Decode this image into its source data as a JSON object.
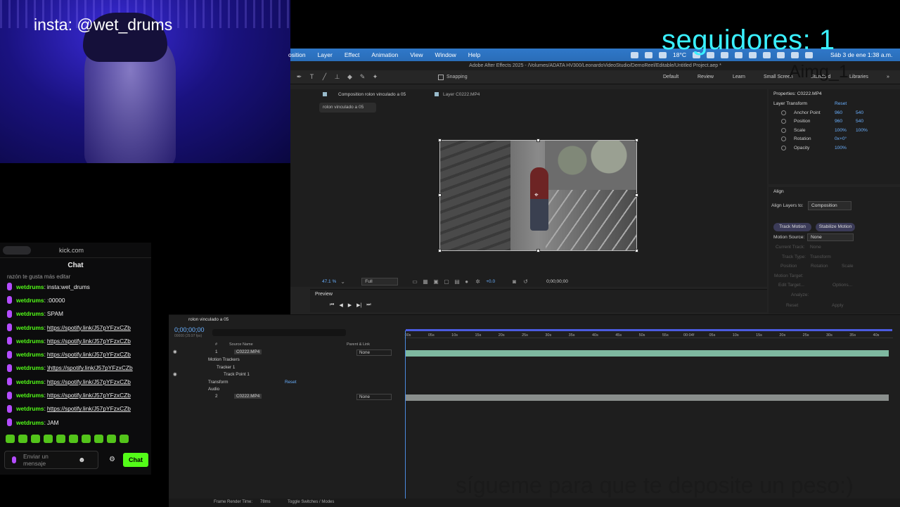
{
  "webcam": {
    "handle": "insta: @wet_drums"
  },
  "overlay": {
    "followers": "seguidores: 1",
    "aimg": "Aimg_1",
    "bottom_text": "sígueme para que te deposite un peso:)"
  },
  "chat": {
    "site": "kick.com",
    "title": "Chat",
    "cut_message": "razón te gusta más editar",
    "messages": [
      {
        "user": "wetdrums",
        "text": "insta:wet_drums",
        "link": false
      },
      {
        "user": "wetdrums",
        "text": ":00000",
        "link": false
      },
      {
        "user": "wetdrums",
        "text": "SPAM",
        "link": false
      },
      {
        "user": "wetdrums",
        "text": "https://spotify.link/J57pYFzxCZb",
        "link": true
      },
      {
        "user": "wetdrums",
        "text": "https://spotify.link/J57pYFzxCZb",
        "link": true
      },
      {
        "user": "wetdrums",
        "text": "https://spotify.link/J57pYFzxCZb",
        "link": true
      },
      {
        "user": "wetdrums",
        "text": ")https://spotify.link/J57pYFzxCZb",
        "link": true
      },
      {
        "user": "wetdrums",
        "text": "https://spotify.link/J57pYFzxCZb",
        "link": true
      },
      {
        "user": "wetdrums",
        "text": "https://spotify.link/J57pYFzxCZb",
        "link": true
      },
      {
        "user": "wetdrums",
        "text": "https://spotify.link/J57pYFzxCZb",
        "link": true
      },
      {
        "user": "wetdrums",
        "text": "JAM",
        "link": false
      }
    ],
    "input_placeholder": "Enviar un mensaje",
    "send_label": "Chat",
    "brand_color": "#53fc18"
  },
  "menubar": {
    "items": [
      "osition",
      "Layer",
      "Effect",
      "Animation",
      "View",
      "Window",
      "Help"
    ],
    "temp": "18°C",
    "clock": "Sáb 3 de ene  1:38 a.m."
  },
  "app": {
    "title": "Adobe After Effects 2025 - /Volumes/ADATA HV300/LeonardoVideoStudio/DemoReel/Editable/Untitled Project.aep *",
    "snapping": "Snapping",
    "workspaces": [
      "Default",
      "Review",
      "Learn",
      "Small Screen",
      "Standard",
      "Libraries"
    ]
  },
  "comp": {
    "tab": "Composition rolon vinculado a 05",
    "layer_tab": "Layer C0222.MP4",
    "crumb": "rolon vinculado a 05",
    "zoom": "47.1",
    "zoom_unit": "%",
    "resolution": "Full",
    "exposure": "+0.0",
    "timecode": "0;00;00;00"
  },
  "preview": {
    "label": "Preview"
  },
  "properties": {
    "header": "Properties: C0222.MP4",
    "section": "Layer Transform",
    "reset": "Reset",
    "rows": [
      {
        "name": "Anchor Point",
        "v1": "960",
        "v2": "540"
      },
      {
        "name": "Position",
        "v1": "960",
        "v2": "540"
      },
      {
        "name": "Scale",
        "v1": "100%",
        "v2": "100%"
      },
      {
        "name": "Rotation",
        "v1": "0x+0°",
        "v2": ""
      },
      {
        "name": "Opacity",
        "v1": "100%",
        "v2": ""
      }
    ]
  },
  "align": {
    "header": "Align",
    "align_to_label": "Align Layers to:",
    "align_to_value": "Composition",
    "track_motion": "Track Motion",
    "stabilize_motion": "Stabilize Motion",
    "motion_source_label": "Motion Source:",
    "motion_source_value": "None",
    "current_track_label": "Current Track:",
    "current_track_value": "None",
    "track_type_label": "Track Type:",
    "track_type_value": "Transform",
    "position": "Position",
    "rotation": "Rotation",
    "scale": "Scale",
    "motion_target": "Motion Target:",
    "edit_target": "Edit Target...",
    "options": "Options...",
    "analyze": "Analyze:",
    "reset": "Reset",
    "apply": "Apply"
  },
  "timeline": {
    "tab": "rolon vinculado a 05",
    "timecode": "0;00;00;00",
    "fps": "00000 (29.97 fps)",
    "col_num": "#",
    "col_source": "Source Name",
    "col_parent": "Parent & Link",
    "layers": [
      {
        "num": "1",
        "name": "C0222.MP4",
        "parent": "None"
      },
      {
        "num": "2",
        "name": "C0222.MP4",
        "parent": "None"
      }
    ],
    "sub_motion_trackers": "Motion Trackers",
    "sub_tracker": "Tracker 1",
    "sub_track_point": "Track Point 1",
    "sub_transform": "Transform",
    "sub_transform_reset": "Reset",
    "sub_audio": "Audio",
    "ruler": [
      "00s",
      "05s",
      "10s",
      "15s",
      "20s",
      "25s",
      "30s",
      "35s",
      "40s",
      "45s",
      "50s",
      "55s",
      "00:04f",
      "05s",
      "10s",
      "15s",
      "20s",
      "25s",
      "30s",
      "35s",
      "40s"
    ],
    "frame_render_label": "Frame Render Time:",
    "frame_render_value": "78ms",
    "toggle": "Toggle Switches / Modes"
  }
}
